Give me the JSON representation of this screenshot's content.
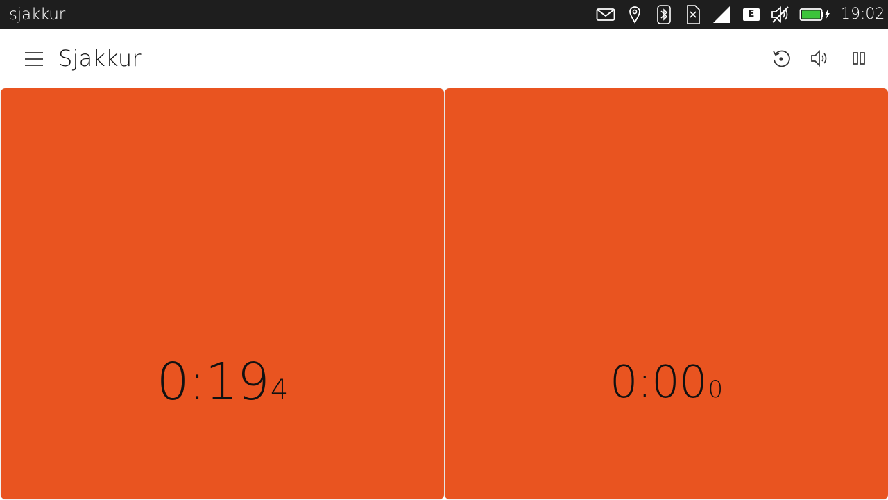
{
  "status_bar": {
    "app_name": "sjakkur",
    "time": "19:02",
    "network_label": "E",
    "battery_color": "#3cc43a",
    "icons": [
      "mail-icon",
      "location-icon",
      "bluetooth-icon",
      "sim-icon",
      "signal-icon",
      "network-type-icon",
      "volume-muted-icon",
      "battery-icon"
    ]
  },
  "header": {
    "title": "Sjakkur",
    "actions": [
      "reset-icon",
      "sound-icon",
      "pause-icon"
    ]
  },
  "clocks": {
    "left": {
      "main": "0:19",
      "tenths": "4",
      "color": "#e95420"
    },
    "right": {
      "main": "0:00",
      "tenths": "0",
      "color": "#e95420"
    }
  },
  "colors": {
    "status_bar_bg": "#1e1e1e",
    "accent": "#e95420"
  }
}
